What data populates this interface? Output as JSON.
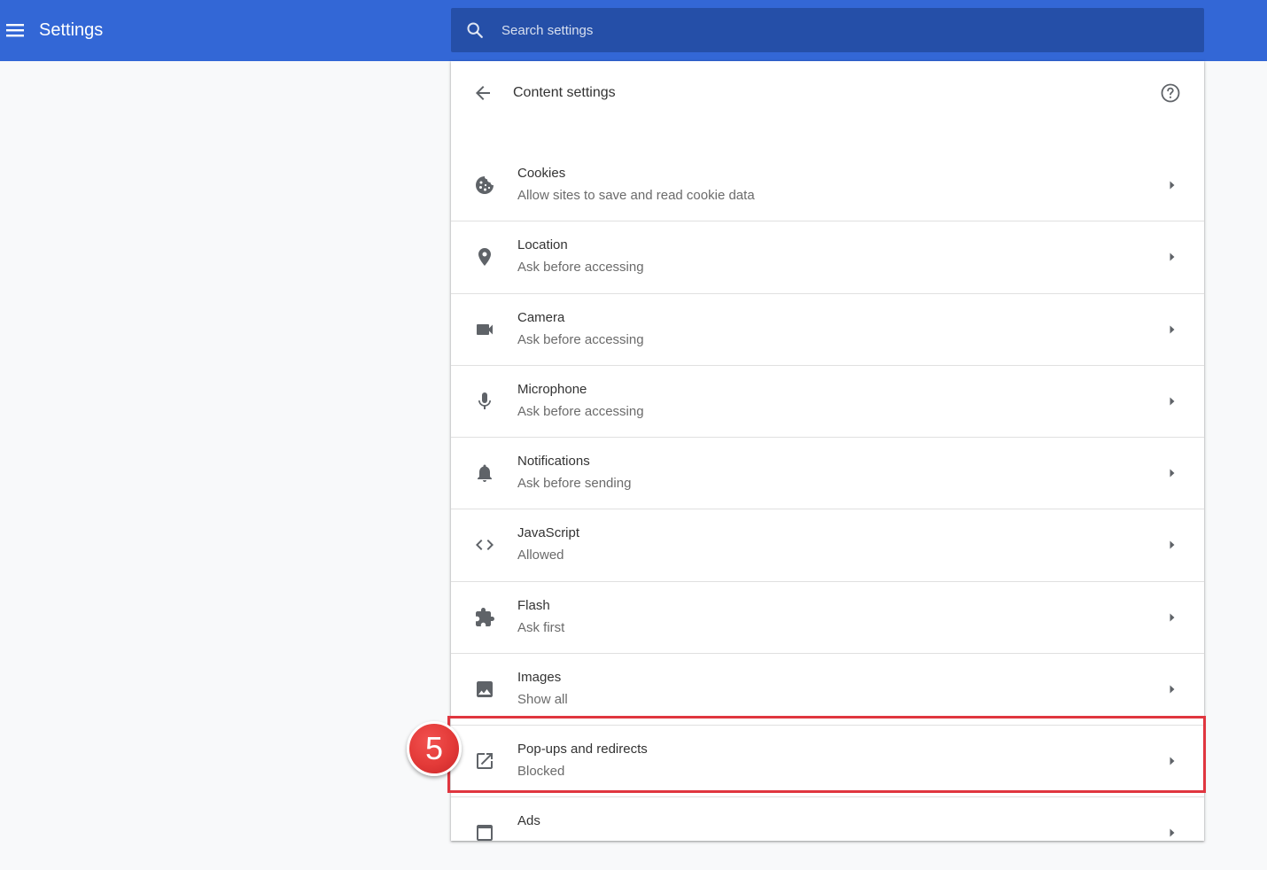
{
  "header": {
    "title": "Settings",
    "menu_icon": "hamburger-menu-icon"
  },
  "search": {
    "placeholder": "Search settings",
    "value": "",
    "icon": "search-icon"
  },
  "content": {
    "title": "Content settings",
    "back_icon": "arrow-back-icon",
    "help_icon": "help-circle-icon"
  },
  "items": [
    {
      "title": "Cookies",
      "subtitle": "Allow sites to save and read cookie data",
      "icon": "cookie-icon"
    },
    {
      "title": "Location",
      "subtitle": "Ask before accessing",
      "icon": "location-pin-icon"
    },
    {
      "title": "Camera",
      "subtitle": "Ask before accessing",
      "icon": "camera-icon"
    },
    {
      "title": "Microphone",
      "subtitle": "Ask before accessing",
      "icon": "microphone-icon"
    },
    {
      "title": "Notifications",
      "subtitle": "Ask before sending",
      "icon": "bell-icon"
    },
    {
      "title": "JavaScript",
      "subtitle": "Allowed",
      "icon": "code-icon"
    },
    {
      "title": "Flash",
      "subtitle": "Ask first",
      "icon": "puzzle-piece-icon"
    },
    {
      "title": "Images",
      "subtitle": "Show all",
      "icon": "image-icon"
    },
    {
      "title": "Pop-ups and redirects",
      "subtitle": "Blocked",
      "icon": "open-in-new-icon"
    },
    {
      "title": "Ads",
      "subtitle": "",
      "icon": "ads-icon"
    }
  ],
  "annotation": {
    "step_number": "5",
    "color": "#e0363f"
  },
  "colors": {
    "topbar": "#3367d6",
    "search_bg": "#254fa8",
    "icon_gray": "#5f6368",
    "background": "#f8f9fa"
  }
}
